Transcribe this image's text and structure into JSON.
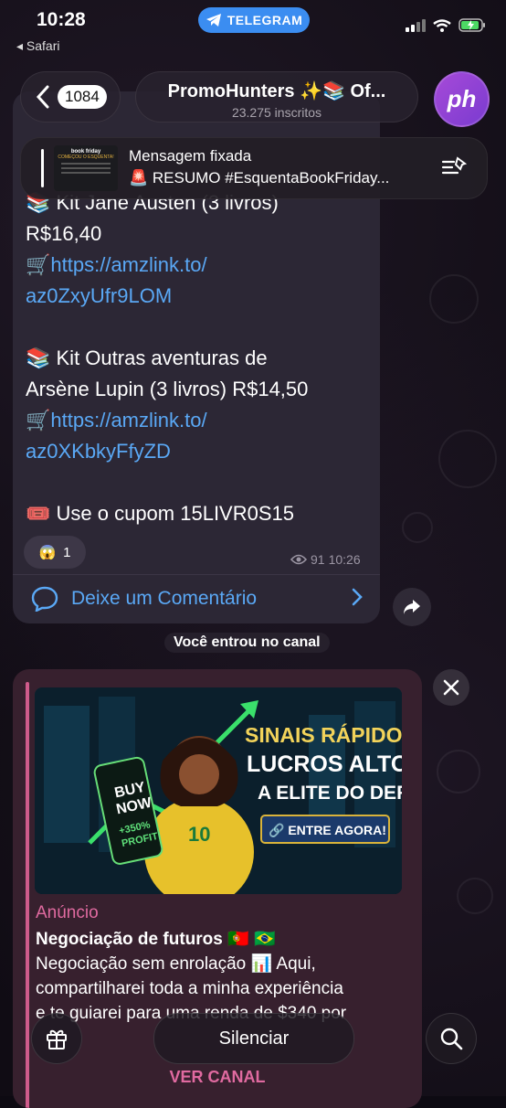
{
  "status_bar": {
    "time": "10:28",
    "back_app": "◂ Safari",
    "app_pill": "TELEGRAM"
  },
  "header": {
    "unread_count": "1084",
    "channel_title": "PromoHunters ✨📚 Of...",
    "subscribers": "23.275 inscritos",
    "avatar_text": "ph"
  },
  "pinned": {
    "label": "Mensagem fixada",
    "text": "🚨 RESUMO #EsquentaBookFriday...",
    "thumb_title": "book friday",
    "thumb_subtitle": "COMEÇOU O ESQUENTA!"
  },
  "message": {
    "lines": [
      {
        "text": "📚 Kit Jane Austen (3 livros)",
        "link": false
      },
      {
        "text": "R$16,40",
        "link": false
      },
      {
        "text": "🛒",
        "link_text": "https://amzlink.to/",
        "link": true
      },
      {
        "text": "az0ZxyUfr9LOM",
        "link": true
      },
      {
        "text": "",
        "link": false
      },
      {
        "text": "📚 Kit Outras aventuras de",
        "link": false
      },
      {
        "text": "Arsène Lupin (3 livros) R$14,50",
        "link": false
      },
      {
        "text": "🛒",
        "link_text": "https://amzlink.to/",
        "link": true
      },
      {
        "text": "az0XKbkyFfyZD",
        "link": true
      },
      {
        "text": "",
        "link": false
      },
      {
        "text": "🎟️ Use o cupom 15LIVR0S15",
        "link": false
      }
    ],
    "reaction_emoji": "😱",
    "reaction_count": "1",
    "views": "91",
    "time": "10:26",
    "comment_label": "Deixe um Comentário"
  },
  "service_message": "Você entrou no canal",
  "ad": {
    "label": "Anúncio",
    "title": "Negociação de futuros 🇵🇹 🇧🇷",
    "body_lines": [
      "Negociação sem enrolação 📊 Aqui,",
      "compartilharei toda a minha experiência",
      "e te guiarei para uma renda de $340 por"
    ],
    "cta": "VER CANAL",
    "image": {
      "headline_1": "SINAIS RÁPIDOS.",
      "headline_2": "LUCROS ALTOS.",
      "headline_3": "A ELITE DO DEFI.",
      "button": "🔗 ENTRE AGORA!",
      "phone_text_1": "BUY",
      "phone_text_2": "NOW",
      "phone_text_3": "+350%",
      "phone_text_4": "PROFIT!",
      "jersey_number": "10"
    }
  },
  "bottom_bar": {
    "mute_label": "Silenciar"
  },
  "colors": {
    "accent_link": "#5aa8f5",
    "ad_accent": "#e06aa0",
    "telegram_blue": "#3b8df1",
    "bubble_bg": "#2c2735"
  }
}
